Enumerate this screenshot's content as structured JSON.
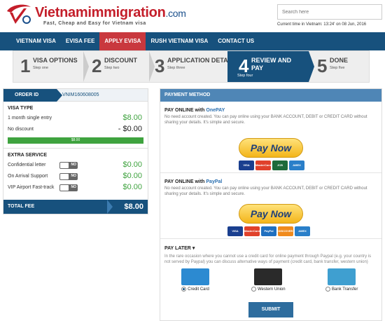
{
  "header": {
    "brand": "Vietnamimmigration",
    "brand_suffix": ".com",
    "tagline": "Fast, Cheap and Easy for Vietnam visa",
    "search_placeholder": "Search here",
    "current_time": "Current time in Vietnam: 13:24' on 08 Jun, 2016"
  },
  "nav": {
    "items": [
      {
        "label": "VIETNAM VISA"
      },
      {
        "label": "EVISA FEE"
      },
      {
        "label": "APPLY EVISA"
      },
      {
        "label": "RUSH VIETNAM VISA"
      },
      {
        "label": "CONTACT US"
      }
    ],
    "active_color": "#c9383e"
  },
  "steps": [
    {
      "num": "1",
      "title": "VISA OPTIONS",
      "sub": "Step one"
    },
    {
      "num": "2",
      "title": "DISCOUNT",
      "sub": "Step two"
    },
    {
      "num": "3",
      "title": "APPLICATION DETAILS",
      "sub": "Step three"
    },
    {
      "num": "4",
      "title": "REVIEW AND",
      "title2": "PAY",
      "sub": "Step four"
    },
    {
      "num": "5",
      "title": "DONE",
      "sub": "Step five"
    }
  ],
  "order": {
    "label": "ORDER ID",
    "id": "VNIM160608005",
    "visa_type_title": "VISA TYPE",
    "entry_label": "1 month single entry",
    "entry_value": "$8.00",
    "discount_label": "No discount",
    "discount_value": "- $0.00",
    "progress_label": "$8.00",
    "extra_title": "EXTRA SERVICE",
    "extras": [
      {
        "label": "Confidential letter",
        "toggle": "NO",
        "value": "$0.00"
      },
      {
        "label": "On Arrival Support",
        "toggle": "NO",
        "value": "$0.00"
      },
      {
        "label": "VIP Airport Fast-track",
        "toggle": "NO",
        "value": "$0.00"
      }
    ],
    "total_label": "TOTAL FEE",
    "total_value": "$8.00"
  },
  "payment": {
    "header": "PAYMENT METHOD",
    "onepay_prefix": "PAY ONLINE with ",
    "onepay_name": "OnePAY",
    "paypal_prefix": "PAY ONLINE with ",
    "paypal_name": "PayPal",
    "desc": "No need account created. You can pay online using your BANK ACCOUNT, DEBIT or CREDIT CARD without sharing your details. It's simple and secure.",
    "pay_now": "Pay Now",
    "onepay_cards": [
      "VISA",
      "MasterCard",
      "JCB",
      "AMEX"
    ],
    "paypal_cards": [
      "VISA",
      "MasterCard",
      "PayPal",
      "DISCOVER",
      "AMEX"
    ],
    "later_title": "PAY LATER",
    "later_desc": "In the rare occasion where you cannot use a credit card for online payment through Paypal (e.g. your country is not served by Paypal) you can discuss alternative ways of payment (credit card, bank transfer, western union)",
    "options": [
      {
        "label": "Credit Card",
        "selected": true
      },
      {
        "label": "Western Union",
        "selected": false
      },
      {
        "label": "Bank Transfer",
        "selected": false
      }
    ],
    "submit": "SUBMIT"
  }
}
